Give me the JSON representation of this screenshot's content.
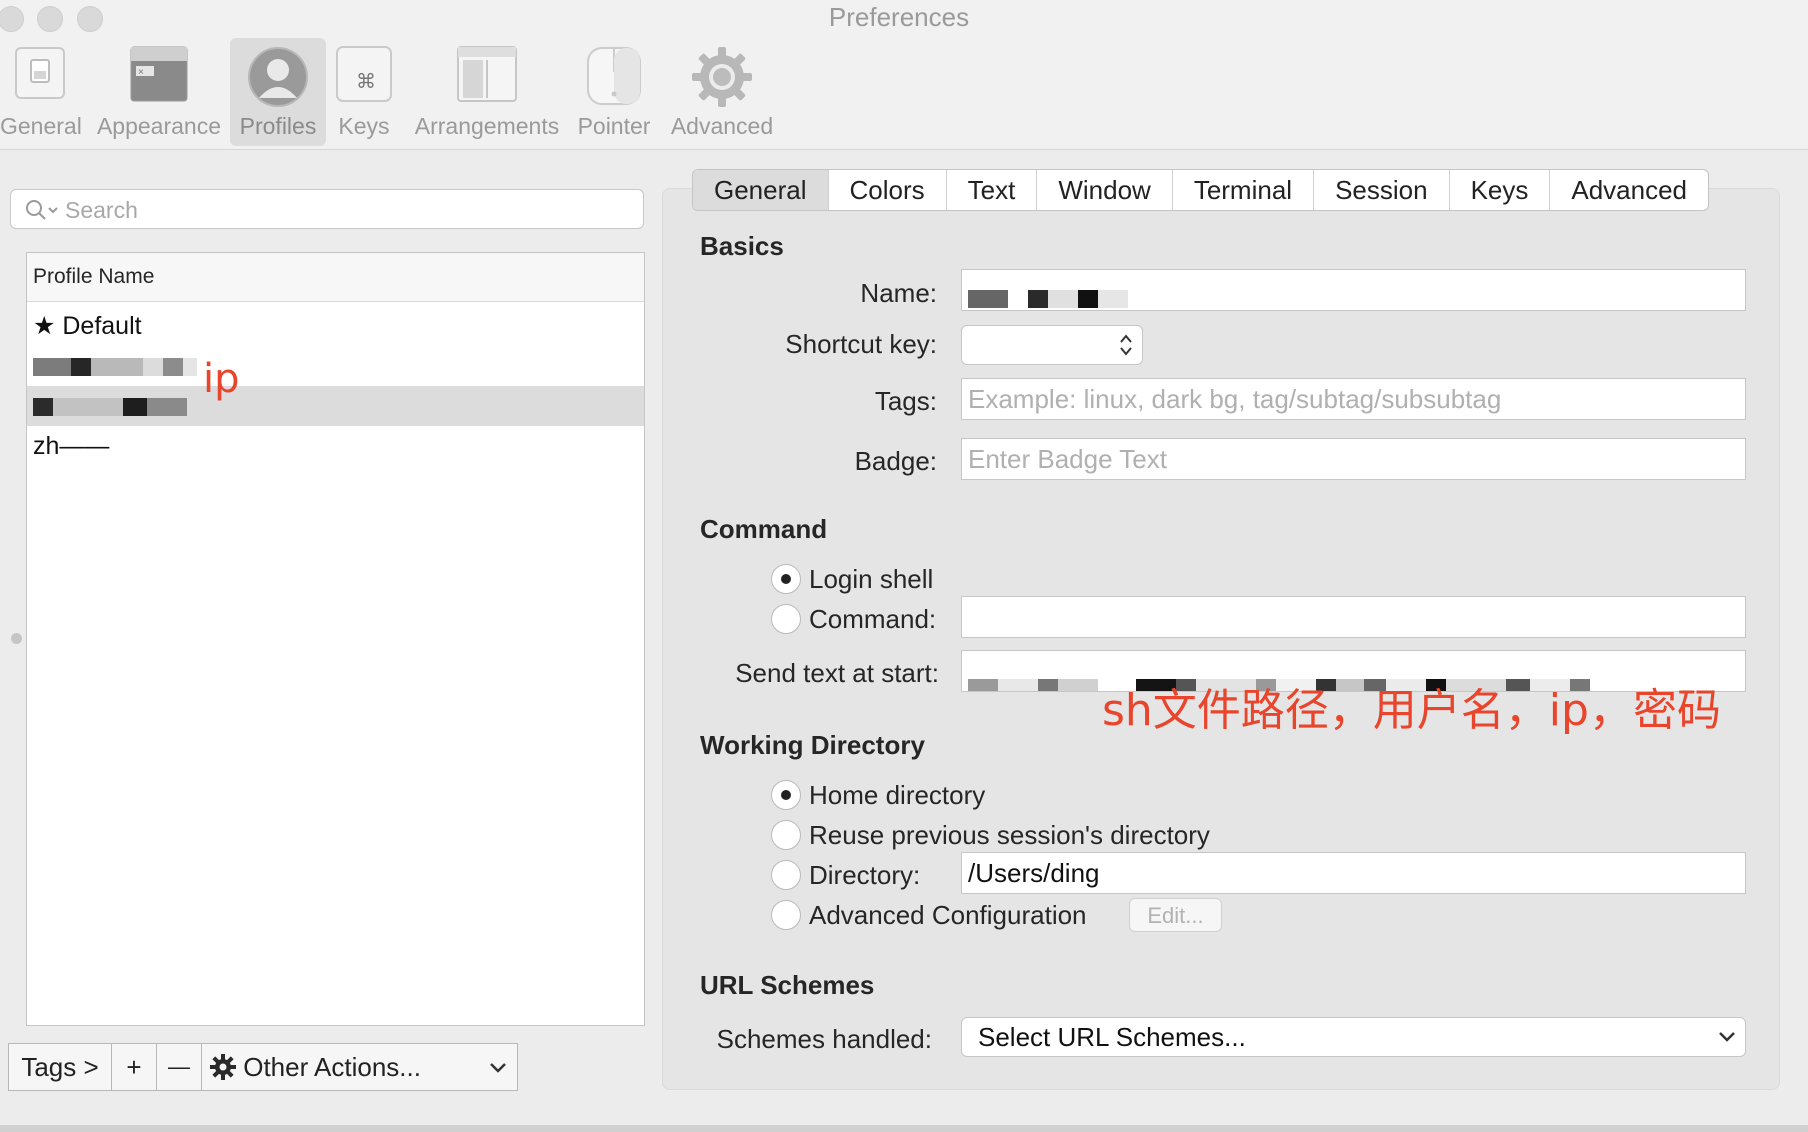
{
  "window": {
    "title": "Preferences"
  },
  "toolbar": {
    "items": [
      {
        "label": "General"
      },
      {
        "label": "Appearance"
      },
      {
        "label": "Profiles"
      },
      {
        "label": "Keys"
      },
      {
        "label": "Arrangements"
      },
      {
        "label": "Pointer"
      },
      {
        "label": "Advanced"
      }
    ],
    "selected": "Profiles"
  },
  "left": {
    "search_placeholder": "Search",
    "list_header": "Profile Name",
    "profiles": [
      {
        "label": "Default",
        "starred": true
      },
      {
        "label": "",
        "redacted": true
      },
      {
        "label": "",
        "redacted": true,
        "selected": true
      },
      {
        "label": "zh——"
      }
    ],
    "annotation_ip": "ip",
    "bottom": {
      "tags": "Tags >",
      "add": "+",
      "remove": "—",
      "other_actions": "Other Actions..."
    }
  },
  "tabs": [
    {
      "label": "General",
      "active": true
    },
    {
      "label": "Colors"
    },
    {
      "label": "Text"
    },
    {
      "label": "Window"
    },
    {
      "label": "Terminal"
    },
    {
      "label": "Session"
    },
    {
      "label": "Keys"
    },
    {
      "label": "Advanced"
    }
  ],
  "basics": {
    "heading": "Basics",
    "name_label": "Name:",
    "shortcut_label": "Shortcut key:",
    "tags_label": "Tags:",
    "tags_placeholder": "Example: linux, dark bg, tag/subtag/subsubtag",
    "badge_label": "Badge:",
    "badge_placeholder": "Enter Badge Text"
  },
  "command": {
    "heading": "Command",
    "login_shell": "Login shell",
    "command_label": "Command:",
    "selected": "login_shell",
    "send_text_label": "Send text at start:",
    "annotation": "sh文件路径，用户名，ip，密码"
  },
  "working_dir": {
    "heading": "Working Directory",
    "home": "Home directory",
    "reuse": "Reuse previous session's directory",
    "directory_label": "Directory:",
    "directory_value": "/Users/ding",
    "advanced": "Advanced Configuration",
    "edit": "Edit...",
    "selected": "home"
  },
  "url_schemes": {
    "heading": "URL Schemes",
    "handled_label": "Schemes handled:",
    "select_value": "Select URL Schemes..."
  }
}
